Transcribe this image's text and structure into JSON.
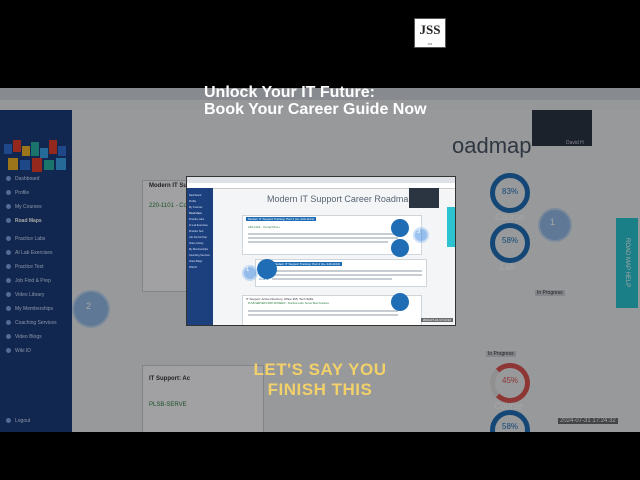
{
  "logo": {
    "text": "JSS",
    "sub": "JSS"
  },
  "headline": {
    "line1": "Unlock Your IT Future:",
    "line2": "Book Your Career Guide Now"
  },
  "caption": {
    "line1": "LET'S SAY YOU",
    "line2": "FINISH THIS"
  },
  "background_page": {
    "title": "oadmap",
    "help_tab": "ROAD MAP HELP",
    "camera_name": "David H",
    "sidebar": [
      "Dashboard",
      "Profile",
      "My Courses",
      "Road Maps",
      "Practice Labs",
      "AI Lab Exercises",
      "Practice Test",
      "Job Find & Prep",
      "Video Library",
      "My Memberships",
      "Coaching Services",
      "Video Blogs",
      "Wiki ID"
    ],
    "sidebar_logout": "Logout",
    "card_heading_1": "Modern IT Su",
    "card_item_1": "220-1101 - Co",
    "card_heading_2": "IT Support: Ac",
    "card_item_2": "PLSB-SERVE",
    "status_1": "In Progress",
    "status_2": "In Progress",
    "ring_labels": [
      "Course",
      "Lab",
      "Course"
    ],
    "ring_values": [
      "83%",
      "58%",
      "45%",
      "58%"
    ],
    "step_numbers": [
      "1",
      "2"
    ],
    "timestamp": "2024-07-31 17:24:32"
  },
  "foreground_page": {
    "title": "Modern IT Support Career Roadmap",
    "card1_heading": "Modern IT Support Training: Part 1 (A+ 220-1101)",
    "card1_item": "220-1101 - CompTIA A+",
    "card2_heading": "Modern IT Support Training: Part 2 (A+ 220-1102)",
    "card3_heading": "IT Support: Active Directory, Office 365, Tech Skills",
    "card3_item": "PLSB-SERVER-FRSH-WINSERV - Practical Labs: Server Best Practices",
    "ring_label": "Course",
    "step_numbers": [
      "1",
      "2",
      "3"
    ],
    "timestamp": "2024-07-31 17:24:32",
    "sidebar": [
      "Dashboard",
      "Profile",
      "My Courses",
      "Road Maps",
      "Practice Labs",
      "AI Lab Exercises",
      "Practice Test",
      "Job Find & Prep",
      "Video Library",
      "My Memberships",
      "Coaching Services",
      "Video Blogs",
      "Wiki ID"
    ]
  },
  "colors": {
    "sidebar": "#1b3d7a",
    "accent": "#1f6db5",
    "help_tab": "#2ac3cf",
    "caption": "#f2d16b"
  }
}
